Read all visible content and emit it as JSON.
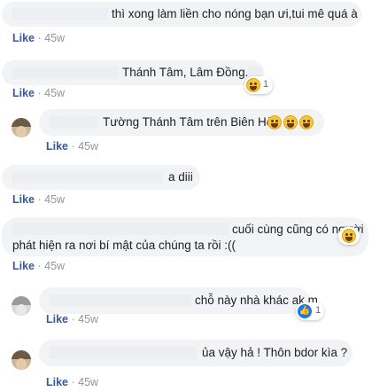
{
  "comments": [
    {
      "text": "thì xong làm liền cho nóng bạn ưi,tui mê quá à",
      "like": "Like",
      "time": "45w"
    },
    {
      "text": "Thánh Tâm, Lâm Đồng.",
      "like": "Like",
      "time": "45w",
      "reaction": {
        "icon": "laughing-emoji-icon",
        "count": "1"
      }
    },
    {
      "text": "Tường Thánh Tâm trên Biên Hòa",
      "like": "Like",
      "time": "45w",
      "inline_emoji": [
        "laughing-emoji-icon",
        "laughing-emoji-icon",
        "laughing-emoji-icon"
      ]
    },
    {
      "text": "a diii",
      "like": "Like",
      "time": "45w"
    },
    {
      "line1": "cuối cùng cũng có người",
      "line2": "phát hiện ra nơi bí mật của chúng ta rồi :((",
      "like": "Like",
      "time": "45w",
      "reaction": {
        "icon": "laughing-emoji-icon",
        "count": ""
      }
    },
    {
      "text": "chỗ này nhà khác ak m",
      "like": "Like",
      "time": "45w",
      "reaction": {
        "icon": "like-icon",
        "count": "1"
      }
    },
    {
      "text": "ủa vậy hả ! Thôn bdor kìa ?",
      "like": "Like",
      "time": "45w"
    }
  ],
  "colors": {
    "like": "#385898",
    "time": "#90949c",
    "bubble": "#f2f3f5"
  }
}
